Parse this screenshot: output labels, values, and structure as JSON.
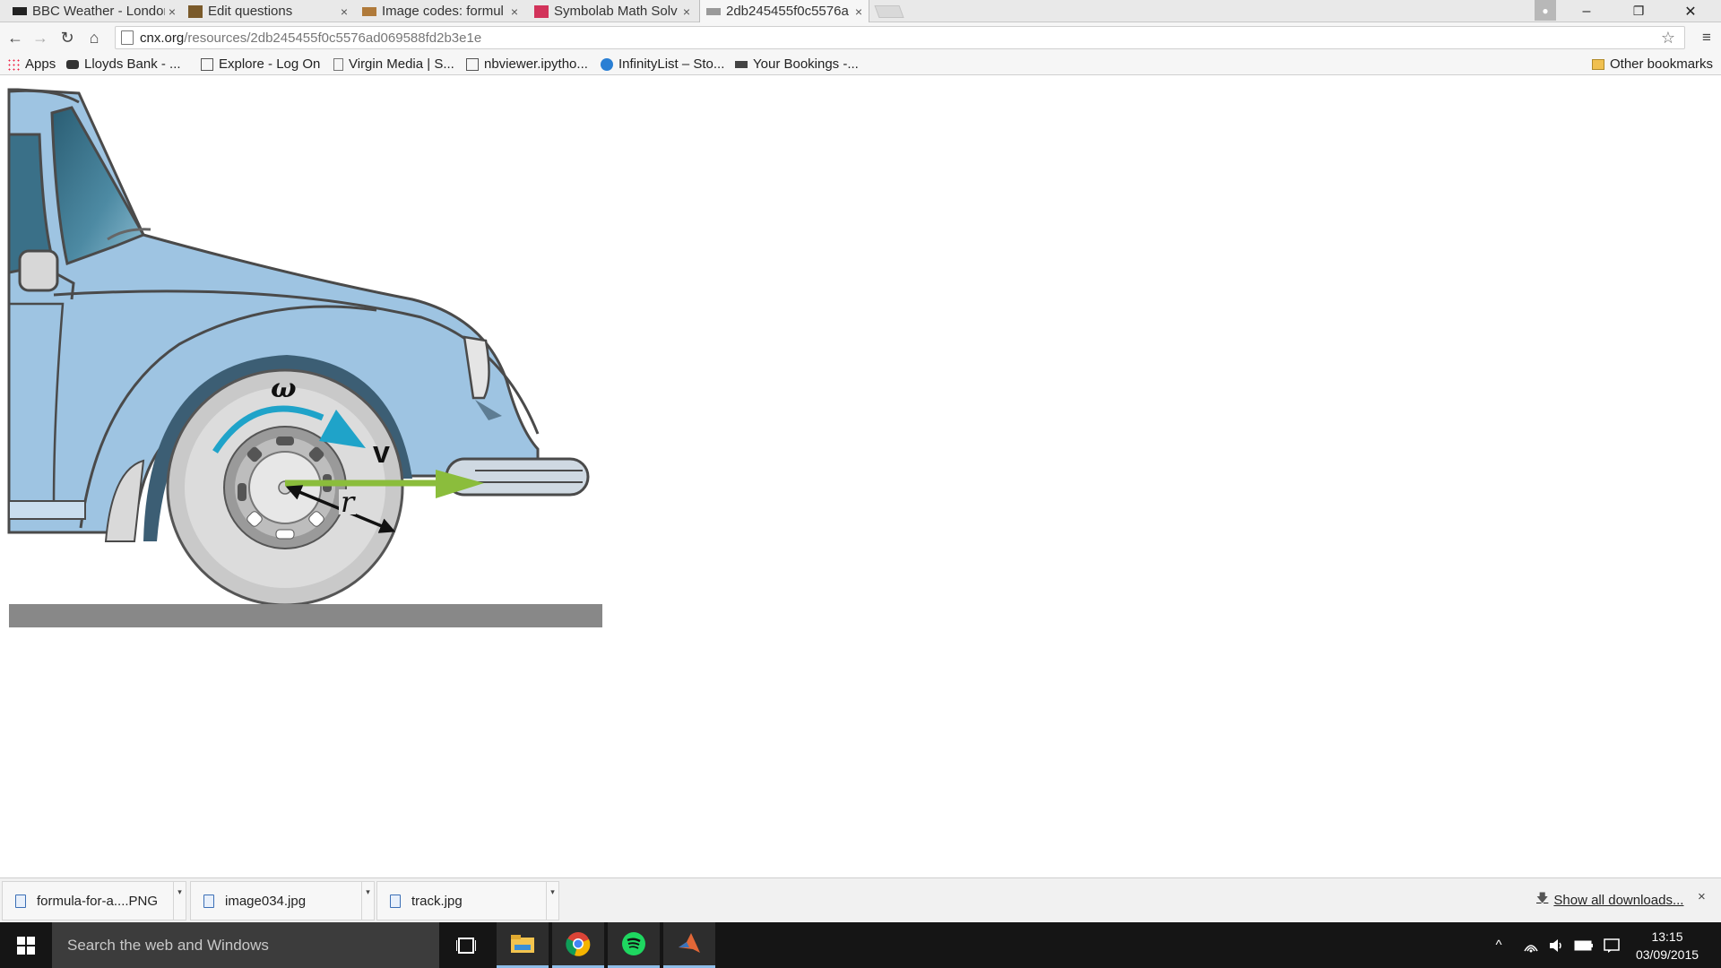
{
  "tabs": [
    {
      "title": "BBC Weather - London",
      "close": "×",
      "icon": "bbc-icon",
      "active": false
    },
    {
      "title": "Edit questions",
      "close": "×",
      "icon": "edit-icon",
      "active": false
    },
    {
      "title": "Image codes: formul",
      "close": "×",
      "icon": "image-icon",
      "active": false
    },
    {
      "title": "Symbolab Math Solv",
      "close": "×",
      "icon": "symbolab-icon",
      "active": false
    },
    {
      "title": "2db245455f0c5576a",
      "close": "×",
      "icon": "page-icon",
      "active": true
    }
  ],
  "window": {
    "minimize": "–",
    "restore": "❐",
    "close": "✕"
  },
  "toolbar": {
    "back": "←",
    "forward": "→",
    "reload": "↻",
    "home": "⌂",
    "url_host": "cnx.org",
    "url_path": "/resources/2db245455f0c5576ad069588fd2b3e1e",
    "star": "☆",
    "menu": "≡"
  },
  "bookmarks": [
    {
      "label": "Apps",
      "icon": "apps-grid-icon"
    },
    {
      "label": "Lloyds Bank - ...",
      "icon": "horse-icon"
    },
    {
      "label": "Explore - Log On",
      "icon": "page-icon"
    },
    {
      "label": "Virgin Media | S...",
      "icon": "page-icon"
    },
    {
      "label": "nbviewer.ipytho...",
      "icon": "nb-icon"
    },
    {
      "label": "InfinityList – Sto...",
      "icon": "globe-icon"
    },
    {
      "label": "Your Bookings -...",
      "icon": "bookings-icon"
    }
  ],
  "other_bookmarks": "Other bookmarks",
  "figure": {
    "omega_label": "ω",
    "v_label": "v",
    "r_label": "r",
    "colors": {
      "car_body": "#9ec4e2",
      "tire": "#c9c9c9",
      "omega_arrow": "#1fa3c9",
      "v_arrow": "#8bbd3c",
      "ground": "#888888"
    }
  },
  "downloads": [
    {
      "name": "formula-for-a....PNG"
    },
    {
      "name": "image034.jpg"
    },
    {
      "name": "track.jpg"
    }
  ],
  "show_all": "Show all downloads...",
  "shelf_close": "×",
  "taskbar": {
    "search_placeholder": "Search the web and Windows",
    "time": "13:15",
    "date": "03/09/2015"
  }
}
